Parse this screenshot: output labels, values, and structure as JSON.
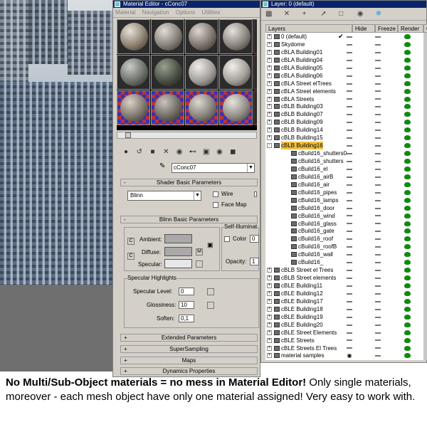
{
  "material_editor": {
    "title": "Material Editor - cConc07",
    "menu": [
      "Material",
      "Navigation",
      "Options",
      "Utilities"
    ],
    "material_name": "cConc07",
    "shader_rollout": {
      "title": "Shader Basic Parameters",
      "shader": "Blinn",
      "wire_label": "Wire",
      "face_map_label": "Face Map"
    },
    "blinn_rollout": {
      "title": "Blinn Basic Parameters",
      "ambient_label": "Ambient:",
      "diffuse_label": "Diffuse:",
      "specular_label": "Specular:",
      "map_button": "M",
      "self_illum_label": "Self-Illuminat",
      "color_label": "Color",
      "color_value": "0",
      "opacity_label": "Opacity:",
      "opacity_value": "1",
      "specular_highlights_label": "Specular Highlights",
      "specular_level_label": "Specular Level:",
      "specular_level_value": "0",
      "glossiness_label": "Glossiness:",
      "glossiness_value": "10",
      "soften_label": "Soften:",
      "soften_value": "0,1"
    },
    "collapsed_rollouts": [
      "Extended Parameters",
      "SuperSampling",
      "Maps",
      "Dynamics Properties"
    ]
  },
  "layer_manager": {
    "title": "Layer: 0 (default)",
    "columns": {
      "layers": "Layers",
      "hide": "Hide",
      "freeze": "Freeze",
      "render": "Render",
      "extra": "C"
    },
    "rows": [
      {
        "name": "0 (default)",
        "level": 0,
        "expander": "+",
        "active": true
      },
      {
        "name": "Skydome",
        "level": 0,
        "expander": "+"
      },
      {
        "name": "cBLA Building01",
        "level": 0,
        "expander": "+"
      },
      {
        "name": "cBLA Building04",
        "level": 0,
        "expander": "+"
      },
      {
        "name": "cBLA Building05",
        "level": 0,
        "expander": "+"
      },
      {
        "name": "cBLA Building06",
        "level": 0,
        "expander": "+"
      },
      {
        "name": "cBLA Street elTrees",
        "level": 0,
        "expander": "+"
      },
      {
        "name": "cBLA Street elements",
        "level": 0,
        "expander": "+"
      },
      {
        "name": "cBLA Streets",
        "level": 0,
        "expander": "+"
      },
      {
        "name": "cBLB Building03",
        "level": 0,
        "expander": "+"
      },
      {
        "name": "cBLB Building07",
        "level": 0,
        "expander": "+"
      },
      {
        "name": "cBLB Building09",
        "level": 0,
        "expander": "+"
      },
      {
        "name": "cBLB Building14",
        "level": 0,
        "expander": "+"
      },
      {
        "name": "cBLB Building15",
        "level": 0,
        "expander": "+"
      },
      {
        "name": "cBLB Building16",
        "level": 0,
        "expander": "-",
        "selected": true
      },
      {
        "name": "cBuild16_shutters0",
        "level": 1
      },
      {
        "name": "cBuild16_shutters",
        "level": 1
      },
      {
        "name": "cBuild16_el",
        "level": 1
      },
      {
        "name": "cBuild16_airB",
        "level": 1
      },
      {
        "name": "cBuild16_air",
        "level": 1
      },
      {
        "name": "cBuild16_pipes",
        "level": 1
      },
      {
        "name": "cBuild16_lamps",
        "level": 1
      },
      {
        "name": "cBuild16_door",
        "level": 1
      },
      {
        "name": "cBuild16_wind",
        "level": 1
      },
      {
        "name": "cBuild16_glass",
        "level": 1
      },
      {
        "name": "cBuild16_gate",
        "level": 1
      },
      {
        "name": "cBuild16_roof",
        "level": 1
      },
      {
        "name": "cBuild16_roofB",
        "level": 1
      },
      {
        "name": "cBuild16_wall",
        "level": 1
      },
      {
        "name": "cBuild16_",
        "level": 1
      },
      {
        "name": "cBLB Street el Trees",
        "level": 0,
        "expander": "+"
      },
      {
        "name": "cBLB Street elements",
        "level": 0,
        "expander": "+"
      },
      {
        "name": "cBLE Building11",
        "level": 0,
        "expander": "+"
      },
      {
        "name": "cBLE Building12",
        "level": 0,
        "expander": "+"
      },
      {
        "name": "cBLE Building17",
        "level": 0,
        "expander": "+"
      },
      {
        "name": "cBLE Building18",
        "level": 0,
        "expander": "+"
      },
      {
        "name": "cBLE Building19",
        "level": 0,
        "expander": "+"
      },
      {
        "name": "cBLE Building20",
        "level": 0,
        "expander": "+"
      },
      {
        "name": "cBLE Street Elements",
        "level": 0,
        "expander": "+"
      },
      {
        "name": "cBLE Streets",
        "level": 0,
        "expander": "+"
      },
      {
        "name": "cBLE Streets El Trees",
        "level": 0,
        "expander": "+"
      },
      {
        "name": "material samples",
        "level": 0,
        "expander": "+",
        "hidden": true
      }
    ]
  },
  "caption": {
    "bold": "No Multi/Sub-Object materials = no mess in Material Editor!",
    "rest": " Only single materials, moreover - each mesh object have only one material assigned! Very easy to work with."
  }
}
